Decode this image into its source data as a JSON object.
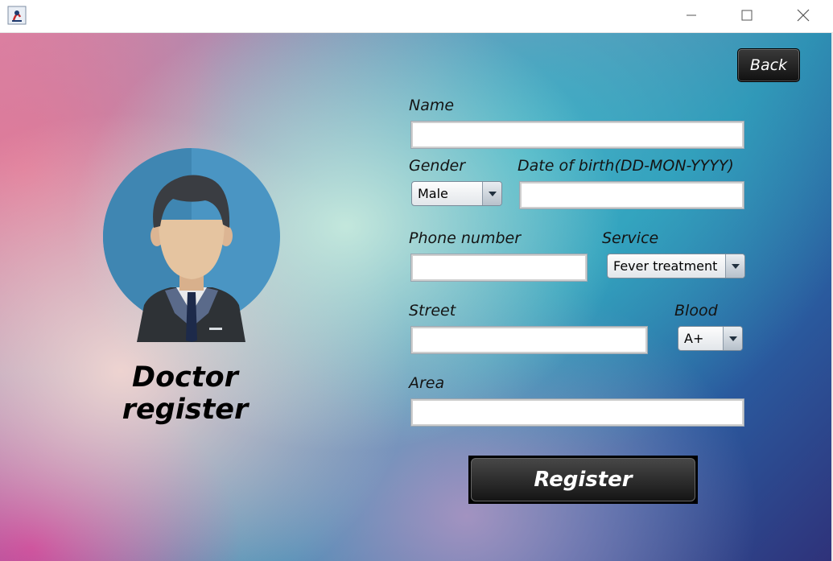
{
  "window": {
    "app_icon": "java-icon",
    "controls": [
      "minimize-icon",
      "maximize-icon",
      "close-icon"
    ]
  },
  "header": {
    "back_label": "Back"
  },
  "left": {
    "avatar_icon": "doctor-avatar-icon",
    "title": "Doctor register"
  },
  "form": {
    "name": {
      "label": "Name",
      "value": ""
    },
    "gender": {
      "label": "Gender",
      "selected": "Male"
    },
    "dob": {
      "label": "Date of birth(DD-MON-YYYY)",
      "value": ""
    },
    "phone": {
      "label": "Phone number",
      "value": ""
    },
    "service": {
      "label": "Service",
      "selected": "Fever treatment"
    },
    "street": {
      "label": "Street",
      "value": ""
    },
    "blood": {
      "label": "Blood",
      "selected": "A+"
    },
    "area": {
      "label": "Area",
      "value": ""
    }
  },
  "actions": {
    "register_label": "Register"
  }
}
